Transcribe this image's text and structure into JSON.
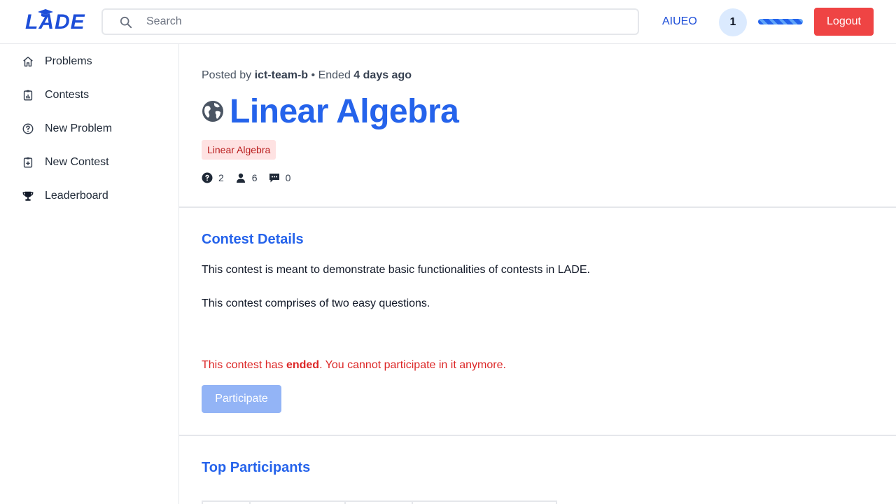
{
  "header": {
    "logo_text": "LADE",
    "search_placeholder": "Search",
    "username": "AIUEO",
    "notification_count": "1",
    "logout_label": "Logout",
    "accent_color": "#2563eb",
    "logout_color": "#ef4444"
  },
  "sidebar": {
    "items": [
      {
        "label": "Problems",
        "icon": "home-icon"
      },
      {
        "label": "Contests",
        "icon": "clipboard-chart-icon"
      },
      {
        "label": "New Problem",
        "icon": "question-circle-icon"
      },
      {
        "label": "New Contest",
        "icon": "clipboard-plus-icon"
      },
      {
        "label": "Leaderboard",
        "icon": "trophy-icon"
      }
    ]
  },
  "contest": {
    "posted_prefix": "Posted by",
    "author": "ict-team-b",
    "separator": "•",
    "ended_prefix": "Ended",
    "ended_ago": "4 days ago",
    "title": "Linear Algebra",
    "visibility_icon": "globe-icon",
    "tag": "Linear Algebra",
    "stats": {
      "problems": "2",
      "participants": "6",
      "comments": "0"
    },
    "details_heading": "Contest Details",
    "description_1": "This contest is meant to demonstrate basic functionalities of contests in LADE.",
    "description_2": "This contest comprises of two easy questions.",
    "ended_notice_prefix": "This contest has",
    "ended_notice_bold": "ended",
    "ended_notice_suffix": ". You cannot participate in it anymore.",
    "participate_label": "Participate",
    "top_participants_heading": "Top Participants"
  }
}
